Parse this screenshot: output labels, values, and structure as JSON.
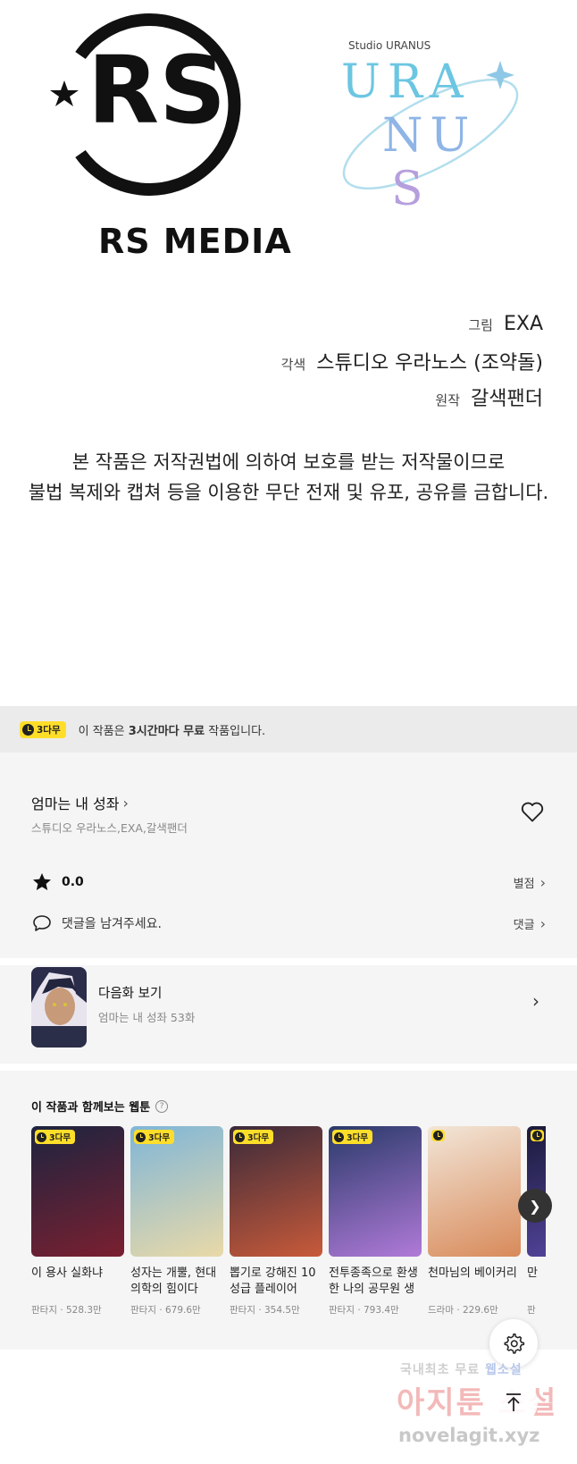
{
  "credits": {
    "rs_logo_text": "RS MEDIA",
    "uranus_studio": "Studio URANUS",
    "uranus_rows": [
      "URA",
      "NU",
      "S"
    ],
    "lines": [
      {
        "role": "그림",
        "name": "EXA"
      },
      {
        "role": "각색",
        "name": "스튜디오 우라노스 (조약돌)"
      },
      {
        "role": "원작",
        "name": "갈색팬더"
      }
    ],
    "notice": [
      "본 작품은 저작권법에 의하여 보호를 받는 저작물이므로",
      "불법 복제와 캡쳐 등을 이용한 무단 전재 및 유포, 공유를 금합니다."
    ]
  },
  "promo": {
    "badge": "3다무",
    "text_prefix": "이 작품은 ",
    "text_bold": "3시간마다 무료",
    "text_suffix": " 작품입니다."
  },
  "work": {
    "title": "엄마는 내 성좌",
    "authors": "스튜디오 우라노스,EXA,갈색팬더",
    "rating": "0.0",
    "rating_link": "별점",
    "comment_placeholder": "댓글을 남겨주세요.",
    "comment_link": "댓글"
  },
  "next_episode": {
    "label": "다음화 보기",
    "sub": "엄마는 내 성좌 53화"
  },
  "recommend": {
    "title": "이 작품과 함께보는 웹툰",
    "items": [
      {
        "name": "이 용사 실화냐",
        "genre": "판타지",
        "views": "528.3만",
        "badge": "3다무",
        "colors": [
          "#1d2440",
          "#7a2030"
        ]
      },
      {
        "name": "성자는 개뿔, 현대의학의 힘이다",
        "genre": "판타지",
        "views": "679.6만",
        "badge": "3다무",
        "colors": [
          "#7fb6d8",
          "#e9d9a8"
        ]
      },
      {
        "name": "뽑기로 강해진 10성급 플레이어",
        "genre": "판타지",
        "views": "354.5만",
        "badge": "3다무",
        "colors": [
          "#3a2a3a",
          "#c85a3a"
        ]
      },
      {
        "name": "전투종족으로 환생한 나의 공무원 생활기",
        "genre": "판타지",
        "views": "793.4만",
        "badge": "3다무",
        "colors": [
          "#2a3a6a",
          "#b07ad8"
        ]
      },
      {
        "name": "천마님의 베이커리",
        "genre": "드라마",
        "views": "229.6만",
        "badge": "",
        "colors": [
          "#f2e6d8",
          "#d88a5a"
        ]
      },
      {
        "name": "만",
        "genre": "판",
        "views": "",
        "badge": "",
        "colors": [
          "#1a1a3a",
          "#5a4aa8"
        ]
      }
    ]
  },
  "watermark": {
    "line1_a": "국내최초 무료",
    "line1_b": "웹소설",
    "line2": "아지툰 소설",
    "line3": "novelagit.xyz"
  }
}
